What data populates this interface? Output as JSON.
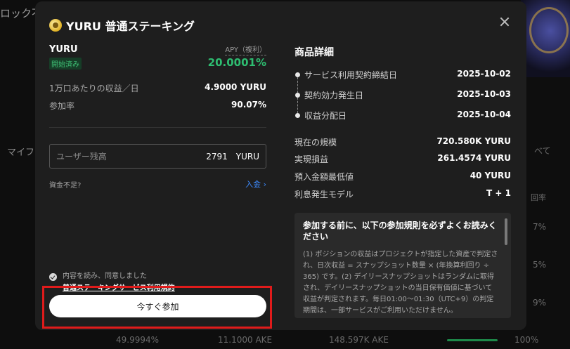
{
  "background": {
    "title_fragment": "ロック不",
    "left_label": "マイフ",
    "right_label_1": "べて",
    "right_label_2": "回率",
    "right_val_1": "7%",
    "right_val_2": "5%",
    "right_val_3": "9%",
    "bottom_row": [
      "49.9994%",
      "11.1000 AKE",
      "148.597K AKE",
      "100%"
    ]
  },
  "modal": {
    "title": "YURU 普通ステーキング",
    "coin_icon": "coin-icon",
    "close_icon": "close-icon",
    "left": {
      "coin_name": "YURU",
      "status": "開始済み",
      "apy_label": "APY（複利）",
      "apy_value": "20.0001%",
      "rows": [
        {
          "label": "1万口あたりの収益／日",
          "value": "4.9000 YURU"
        },
        {
          "label": "参加率",
          "value": "90.07%"
        }
      ],
      "balance": {
        "label": "ユーザー残高",
        "value": "2791　YURU"
      },
      "insufficient": "資金不足?",
      "deposit": "入金 ›",
      "agree_text": "内容を読み、同意しました",
      "agree_link": "普通ステーキングサービス利用規約",
      "join_button": "今すぐ参加"
    },
    "right": {
      "title": "商品詳細",
      "timeline": [
        {
          "label": "サービス利用契約締結日",
          "value": "2025-10-02"
        },
        {
          "label": "契約効力発生日",
          "value": "2025-10-03"
        },
        {
          "label": "収益分配日",
          "value": "2025-10-04"
        }
      ],
      "metrics": [
        {
          "label": "現在の規模",
          "value": "720.580K YURU"
        },
        {
          "label": "実現損益",
          "value": "261.4574 YURU"
        },
        {
          "label": "預入金額最低値",
          "value": "40 YURU"
        },
        {
          "label": "利息発生モデル",
          "value": "T + 1"
        }
      ],
      "rules_title": "参加する前に、以下の参加規則を必ずよくお読みください",
      "rules_body": "(1) ポジションの収益はプロジェクトが指定した資産で判定され、日次収益 = スナップショット数量 × (年換算利回り ÷ 365) です。(2) デイリースナップショットはランダムに取得され、デイリースナップショットの当日保有価値に基づいて収益が判定されます。毎日01:00～01:30（UTC+9）の判定期間は、一部サービスがご利用いただけません。"
    }
  }
}
